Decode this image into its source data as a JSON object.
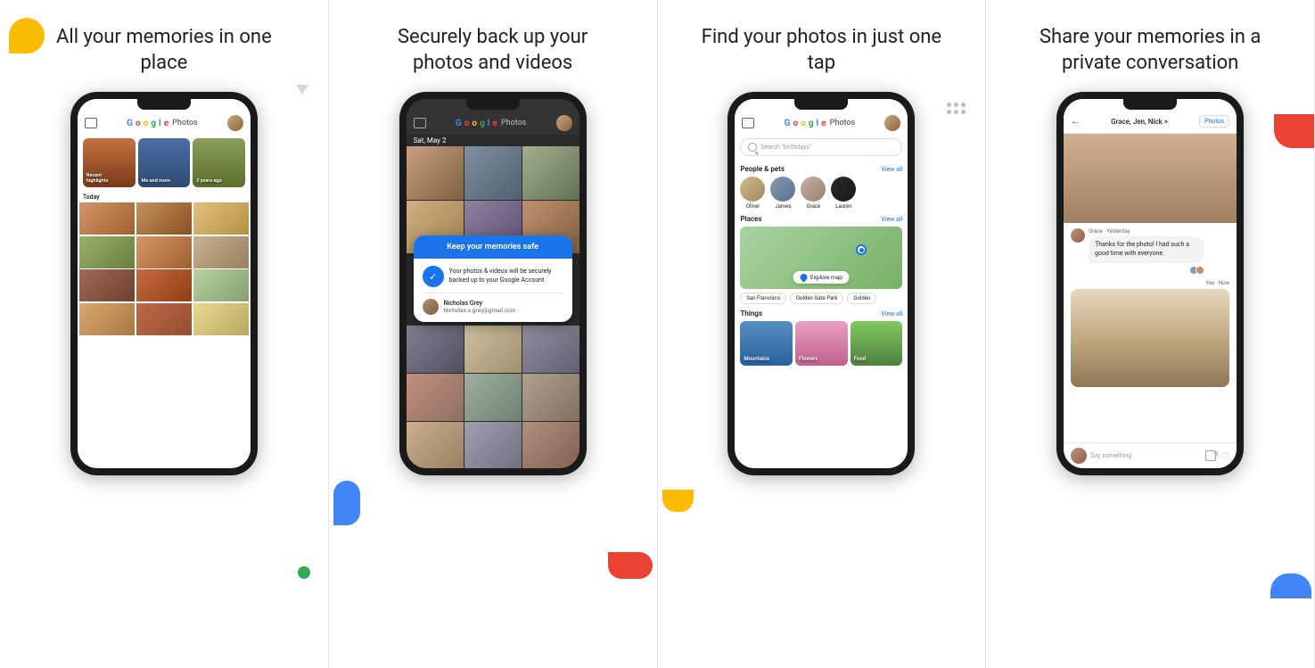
{
  "panels": [
    {
      "id": "panel1",
      "title": "All your memories\nin one place",
      "screen": {
        "header": {
          "logo": "Google Photos",
          "chat_icon": true,
          "avatar": true
        },
        "highlights": [
          {
            "label": "Recent\nhighlights",
            "class": "hc1"
          },
          {
            "label": "Me and mom",
            "class": "hc2"
          },
          {
            "label": "2 years ago",
            "class": "hc3"
          }
        ],
        "section_label": "Today"
      }
    },
    {
      "id": "panel2",
      "title": "Securely back up your\nphotos and videos",
      "screen": {
        "date": "Sat, May 2",
        "modal": {
          "header": "Keep your memories safe",
          "body_text": "Your photos & videos will be securely\nbacked up to your Google Account.",
          "user_name": "Nicholas Grey",
          "user_email": "Nicholas.s.grey@gmail.com"
        }
      }
    },
    {
      "id": "panel3",
      "title": "Find your photos in\njust one tap",
      "screen": {
        "search_placeholder": "Search \"birthdays\"",
        "people_section": {
          "title": "People & pets",
          "view_all": "View all",
          "people": [
            {
              "name": "Oliver",
              "class": "pa1"
            },
            {
              "name": "James",
              "class": "pa2"
            },
            {
              "name": "Grace",
              "class": "pa3"
            },
            {
              "name": "Lauren",
              "class": "pa4"
            }
          ]
        },
        "places_section": {
          "title": "Places",
          "view_all": "View all",
          "explore_map": "Explore map",
          "tags": [
            "San Francisco",
            "Golden Gate Park",
            "Golden"
          ]
        },
        "things_section": {
          "title": "Things",
          "view_all": "View all",
          "things": [
            {
              "label": "Mountains",
              "class": "th1"
            },
            {
              "label": "Flowers",
              "class": "th2"
            },
            {
              "label": "Food",
              "class": "th3"
            }
          ]
        }
      }
    },
    {
      "id": "panel4",
      "title": "Share your memories\nin a private conversation",
      "screen": {
        "header": {
          "back": "←",
          "title": "Grace, Jen, Nick >",
          "photos_btn": "Photos"
        },
        "message1": {
          "sender": "Grace · Yesterday",
          "text": "Thanks for the photo! I had such a\ngood time with everyone."
        },
        "message2_label": "You · Now",
        "input_placeholder": "Say something"
      }
    }
  ],
  "colors": {
    "blue": "#4285F4",
    "red": "#EA4335",
    "yellow": "#FBBC04",
    "green": "#34A853",
    "dark_blue": "#1a73e8"
  }
}
